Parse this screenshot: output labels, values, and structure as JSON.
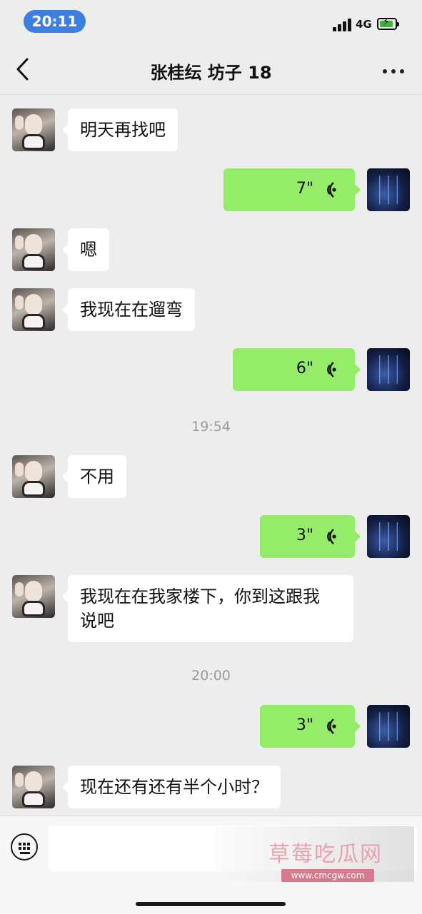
{
  "status_bar": {
    "time": "20:11",
    "network": "4G"
  },
  "header": {
    "title": "张桂纭 坊子 18"
  },
  "messages": [
    {
      "side": "left",
      "type": "text",
      "text": "明天再找吧"
    },
    {
      "side": "right",
      "type": "voice",
      "duration": "7\""
    },
    {
      "side": "left",
      "type": "text",
      "text": "嗯"
    },
    {
      "side": "left",
      "type": "text",
      "text": "我现在在遛弯"
    },
    {
      "side": "right",
      "type": "voice",
      "duration": "6\""
    },
    {
      "type": "time",
      "text": "19:54"
    },
    {
      "side": "left",
      "type": "text",
      "text": "不用"
    },
    {
      "side": "right",
      "type": "voice",
      "duration": "3\""
    },
    {
      "side": "left",
      "type": "text",
      "text": "我现在在我家楼下，你到这跟我说吧",
      "line1": "我现在在我家楼下，你到这跟我",
      "line2": "说吧"
    },
    {
      "type": "time",
      "text": "20:00"
    },
    {
      "side": "right",
      "type": "voice",
      "duration": "3\""
    },
    {
      "side": "left",
      "type": "text",
      "text": "现在还有还有半个小时？"
    }
  ],
  "input": {
    "value": ""
  },
  "watermark": {
    "title": "草莓吃瓜网",
    "url": "www.cmcgw.com"
  }
}
